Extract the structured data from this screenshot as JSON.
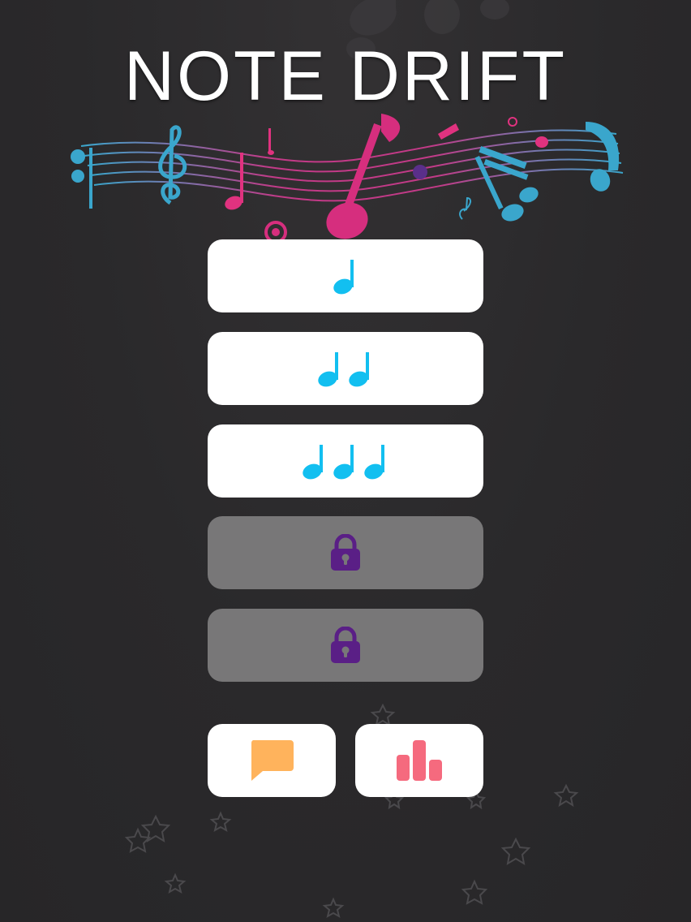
{
  "title": "NOTE DRIFT",
  "colors": {
    "note": "#12bff0",
    "lock": "#5a1f86",
    "chat": "#ffb35c",
    "stats": "#f56a7e",
    "staff_pink": "#e0327f",
    "staff_blue": "#3aa6cc"
  },
  "levels": [
    {
      "state": "unlocked",
      "notes": 1
    },
    {
      "state": "unlocked",
      "notes": 2
    },
    {
      "state": "unlocked",
      "notes": 3
    },
    {
      "state": "locked",
      "icon": "lock-icon"
    },
    {
      "state": "locked",
      "icon": "lock-icon"
    }
  ],
  "buttons": {
    "feedback_icon": "speech-bubble-icon",
    "leaderboard_icon": "bar-chart-icon"
  }
}
